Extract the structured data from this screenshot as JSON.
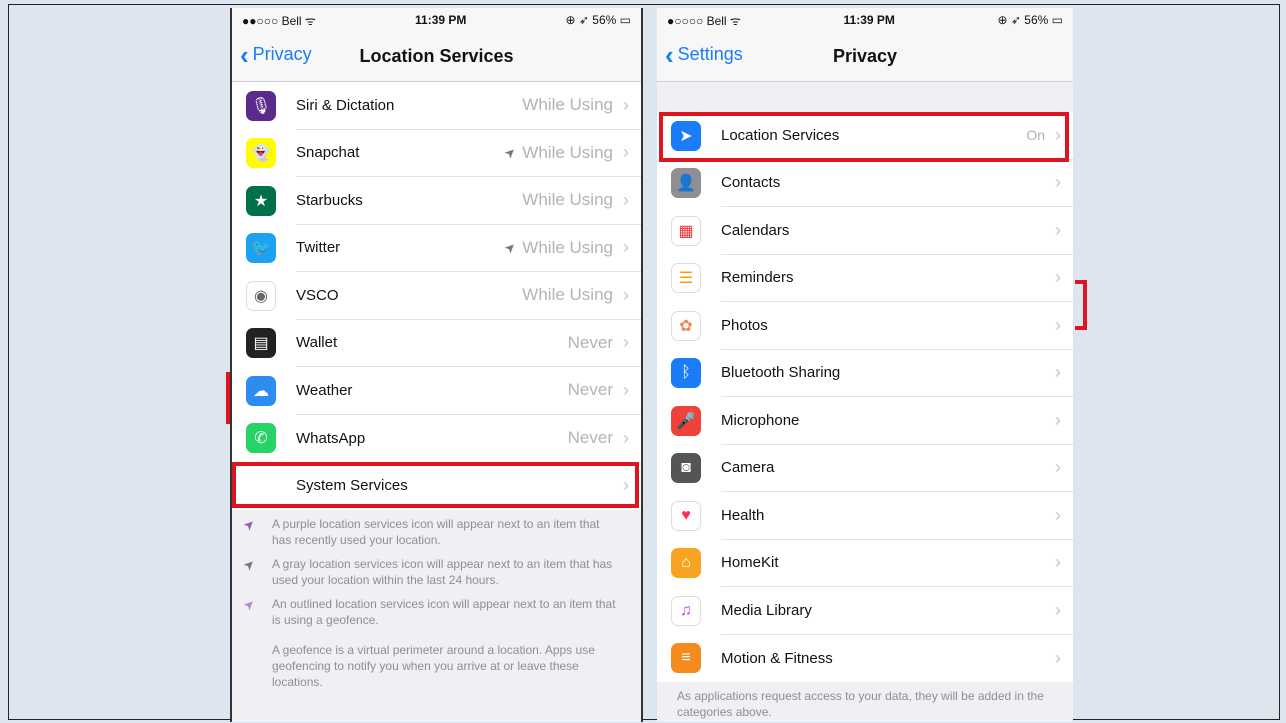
{
  "left": {
    "status": {
      "carrier": "●●○○○ Bell ᯤ",
      "time": "11:39 PM",
      "battery": "⊕ ➶ 56% ▭"
    },
    "nav": {
      "back": "Privacy",
      "title": "Location Services"
    },
    "rows": [
      {
        "label": "Siri & Dictation",
        "value": "While Using",
        "arrow": false,
        "icon": "siri-icon",
        "color": "#5a2a8c"
      },
      {
        "label": "Snapchat",
        "value": "While Using",
        "arrow": true,
        "icon": "snapchat-icon",
        "color": "#fffc00"
      },
      {
        "label": "Starbucks",
        "value": "While Using",
        "arrow": false,
        "icon": "starbucks-icon",
        "color": "#00704a"
      },
      {
        "label": "Twitter",
        "value": "While Using",
        "arrow": true,
        "icon": "twitter-icon",
        "color": "#1da1f2"
      },
      {
        "label": "VSCO",
        "value": "While Using",
        "arrow": false,
        "icon": "vsco-icon",
        "color": "#ffffff"
      },
      {
        "label": "Wallet",
        "value": "Never",
        "arrow": false,
        "icon": "wallet-icon",
        "color": "#222222"
      },
      {
        "label": "Weather",
        "value": "Never",
        "arrow": false,
        "icon": "weather-icon",
        "color": "#2d8cf0"
      },
      {
        "label": "WhatsApp",
        "value": "Never",
        "arrow": false,
        "icon": "whatsapp-icon",
        "color": "#25d366"
      }
    ],
    "system": "System Services",
    "notes": [
      {
        "text": "A purple location services icon will appear next to an item that has recently used your location.",
        "color": "#9b59b6"
      },
      {
        "text": "A gray location services icon will appear next to an item that has used your location within the last 24 hours.",
        "color": "#777777"
      },
      {
        "text": "An outlined location services icon will appear next to an item that is using a geofence.",
        "color": "#b38ad6"
      }
    ],
    "geofence": "A geofence is a virtual perimeter around a location. Apps use geofencing to notify you when you arrive at or leave these locations."
  },
  "right": {
    "status": {
      "carrier": "●○○○○ Bell ᯤ",
      "time": "11:39 PM",
      "battery": "⊕ ➶ 56% ▭"
    },
    "nav": {
      "back": "Settings",
      "title": "Privacy"
    },
    "rows": [
      {
        "label": "Location Services",
        "value": "On",
        "icon": "location-icon",
        "color": "#1a7cf7"
      },
      {
        "label": "Contacts",
        "value": "",
        "icon": "contacts-icon",
        "color": "#8e8e93"
      },
      {
        "label": "Calendars",
        "value": "",
        "icon": "calendar-icon",
        "color": "#ffffff"
      },
      {
        "label": "Reminders",
        "value": "",
        "icon": "reminders-icon",
        "color": "#ffffff"
      },
      {
        "label": "Photos",
        "value": "",
        "icon": "photos-icon",
        "color": "#ffffff"
      },
      {
        "label": "Bluetooth Sharing",
        "value": "",
        "icon": "bluetooth-icon",
        "color": "#1a7cf7"
      },
      {
        "label": "Microphone",
        "value": "",
        "icon": "microphone-icon",
        "color": "#f0413a"
      },
      {
        "label": "Camera",
        "value": "",
        "icon": "camera-icon",
        "color": "#555555"
      },
      {
        "label": "Health",
        "value": "",
        "icon": "health-icon",
        "color": "#ffffff"
      },
      {
        "label": "HomeKit",
        "value": "",
        "icon": "homekit-icon",
        "color": "#f7a520"
      },
      {
        "label": "Media Library",
        "value": "",
        "icon": "music-icon",
        "color": "#ffffff"
      },
      {
        "label": "Motion & Fitness",
        "value": "",
        "icon": "motion-icon",
        "color": "#f58a1f"
      }
    ],
    "footer": "As applications request access to your data, they will be added in the categories above."
  }
}
